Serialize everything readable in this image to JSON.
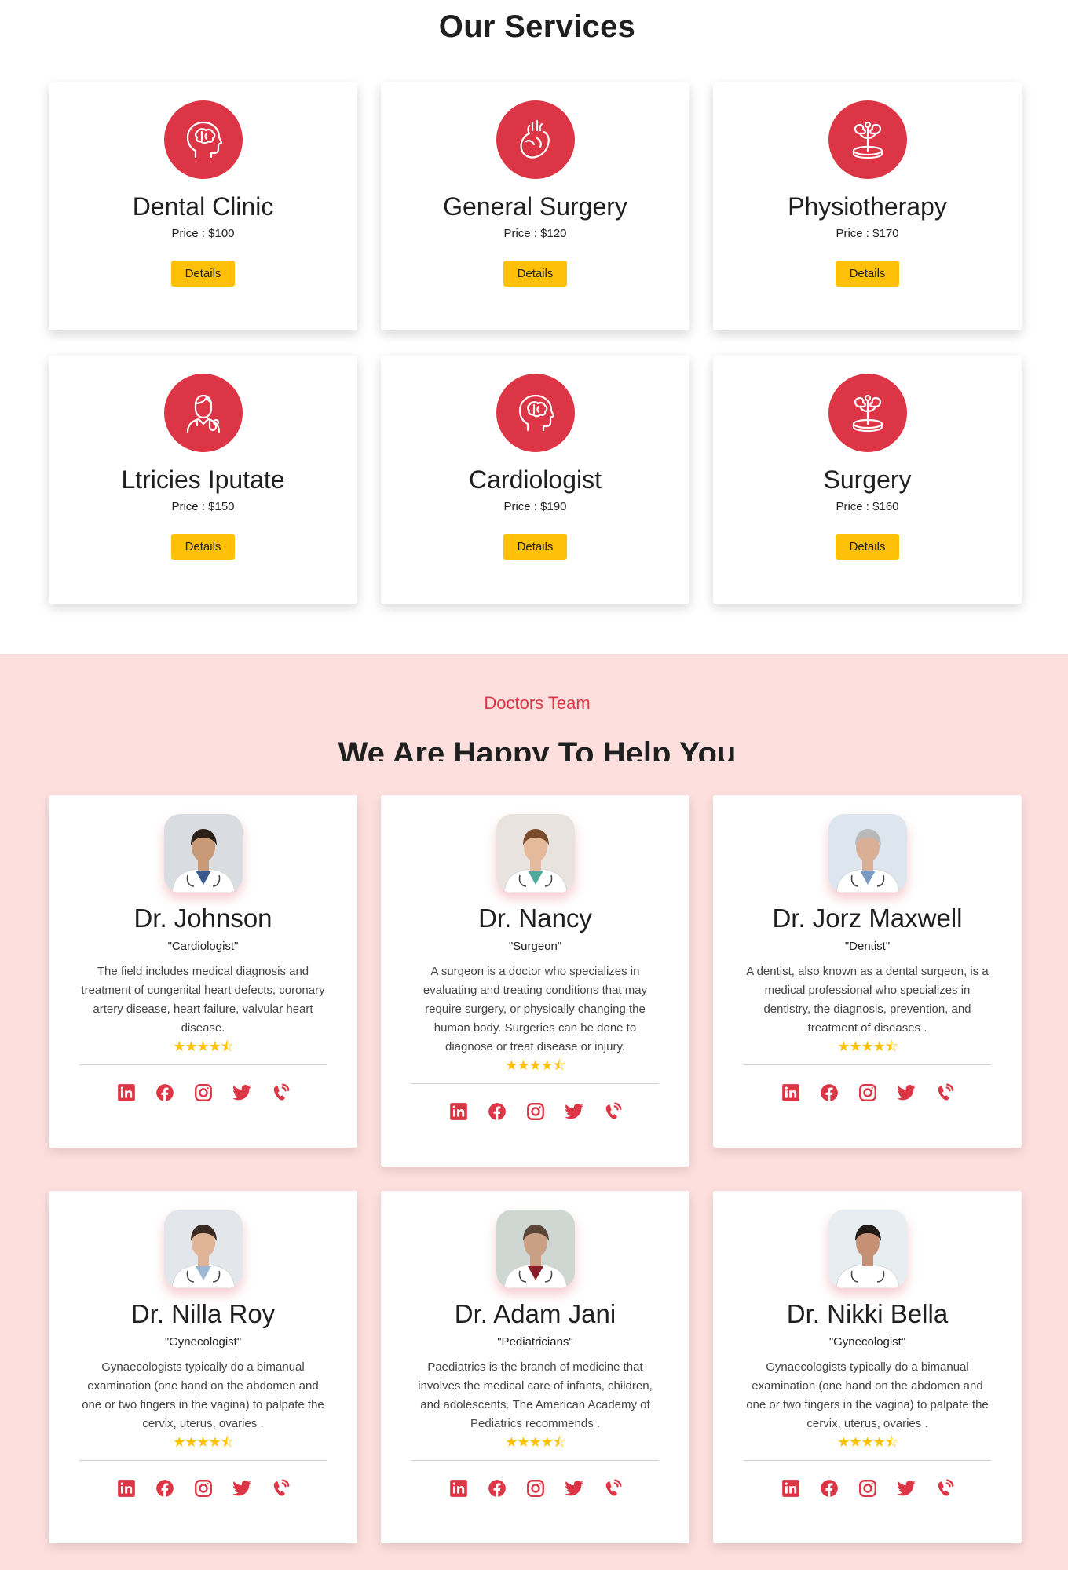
{
  "services": {
    "title": "Our Services",
    "accent_color": "#dc3545",
    "button_color": "#ffc107",
    "items": [
      {
        "name": "Dental Clinic",
        "price": "Price : $100",
        "button": "Details",
        "icon": "brain-head-icon"
      },
      {
        "name": "General Surgery",
        "price": "Price : $120",
        "button": "Details",
        "icon": "heart-organ-icon"
      },
      {
        "name": "Physiotherapy",
        "price": "Price : $170",
        "button": "Details",
        "icon": "organ-scale-icon"
      },
      {
        "name": "Ltricies Iputate",
        "price": "Price : $150",
        "button": "Details",
        "icon": "doctor-icon"
      },
      {
        "name": "Cardiologist",
        "price": "Price : $190",
        "button": "Details",
        "icon": "brain-head-icon"
      },
      {
        "name": "Surgery",
        "price": "Price : $160",
        "button": "Details",
        "icon": "organ-scale-icon"
      }
    ]
  },
  "doctors": {
    "label": "Doctors Team",
    "heading": "We Are Happy To Help You",
    "background_color": "#fde0dd",
    "rating_stars": "★★★★⯪",
    "social_icons": [
      "linkedin-icon",
      "facebook-icon",
      "instagram-icon",
      "twitter-icon",
      "phone-icon"
    ],
    "items": [
      {
        "name": "Dr. Johnson",
        "specialty": "\"Cardiologist\"",
        "description": "The field includes medical diagnosis and treatment of congenital heart defects, coronary artery disease, heart failure, valvular heart disease.",
        "rating": 4.5
      },
      {
        "name": "Dr. Nancy",
        "specialty": "\"Surgeon\"",
        "description": "A surgeon is a doctor who specializes in evaluating and treating conditions that may require surgery, or physically changing the human body. Surgeries can be done to diagnose or treat disease or injury.",
        "rating": 4.5
      },
      {
        "name": "Dr. Jorz Maxwell",
        "specialty": "\"Dentist\"",
        "description": "A dentist, also known as a dental surgeon, is a medical professional who specializes in dentistry, the diagnosis, prevention, and treatment of diseases .",
        "rating": 4.5
      },
      {
        "name": "Dr. Nilla Roy",
        "specialty": "\"Gynecologist\"",
        "description": "Gynaecologists typically do a bimanual examination (one hand on the abdomen and one or two fingers in the vagina) to palpate the cervix, uterus, ovaries .",
        "rating": 4.5
      },
      {
        "name": "Dr. Adam Jani",
        "specialty": "\"Pediatricians\"",
        "description": "Paediatrics is the branch of medicine that involves the medical care of infants, children, and adolescents. The American Academy of Pediatrics recommends .",
        "rating": 4.5
      },
      {
        "name": "Dr. Nikki Bella",
        "specialty": "\"Gynecologist\"",
        "description": "Gynaecologists typically do a bimanual examination (one hand on the abdomen and one or two fingers in the vagina) to palpate the cervix, uterus, ovaries .",
        "rating": 4.5
      }
    ]
  }
}
